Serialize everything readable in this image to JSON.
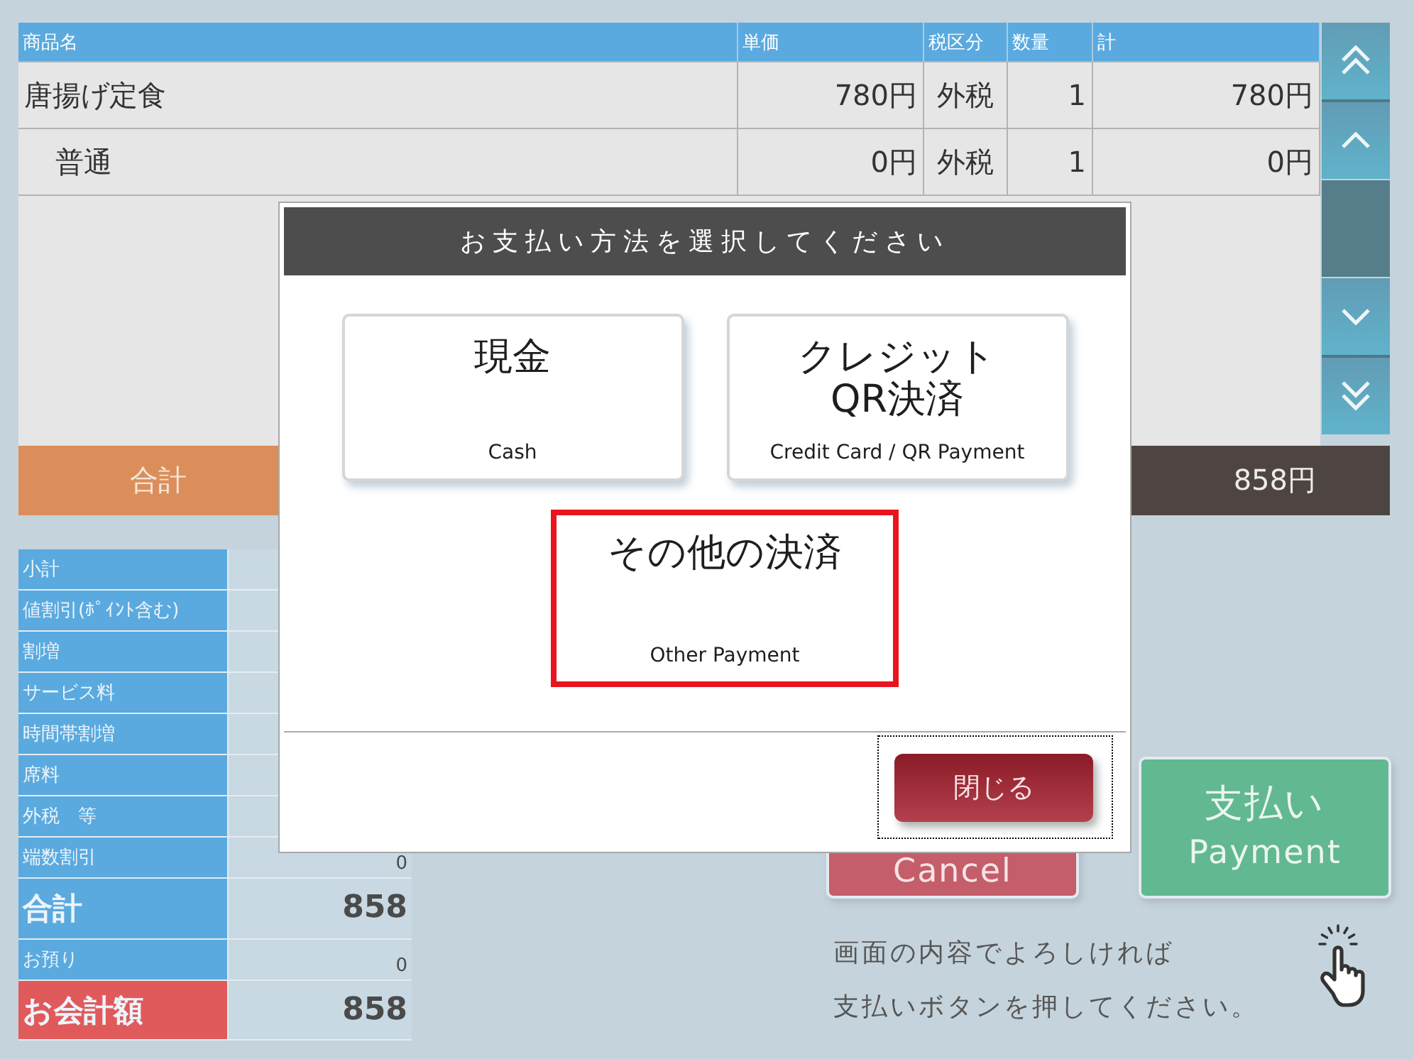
{
  "items_table": {
    "columns": [
      "商品名",
      "単価",
      "税区分",
      "数量",
      "計"
    ],
    "rows": [
      {
        "cells": [
          "唐揚げ定食",
          "780円",
          "外税",
          "1",
          "780円"
        ],
        "children": [
          {
            "cells": [
              "普通",
              "0円",
              "外税",
              "1",
              "0円"
            ]
          }
        ]
      }
    ]
  },
  "total_bar": {
    "label": "合計",
    "amount": "858円"
  },
  "summary": {
    "rows": [
      {
        "label": "小計",
        "kind": "normal"
      },
      {
        "label": "値割引(ﾎﾟｲﾝﾄ含む)",
        "kind": "normal"
      },
      {
        "label": "割増",
        "kind": "normal"
      },
      {
        "label": "サービス料",
        "kind": "normal"
      },
      {
        "label": "時間帯割増",
        "kind": "normal"
      },
      {
        "label": "席料",
        "kind": "normal"
      },
      {
        "label": "外税　等",
        "kind": "normal"
      },
      {
        "label": "端数割引",
        "value": "0",
        "kind": "normal"
      },
      {
        "label": "合計",
        "value": "858",
        "kind": "total"
      },
      {
        "label": "お預り",
        "value": "0",
        "kind": "normal"
      },
      {
        "label": "お会計額",
        "value": "858",
        "kind": "grand"
      }
    ]
  },
  "actions": {
    "cancel": {
      "label": "Cancel"
    },
    "payment": {
      "label": "支払い",
      "sublabel": "Payment"
    }
  },
  "instruction": [
    "画面の内容でよろしければ",
    "支払いボタンを押してください。"
  ],
  "dialog": {
    "title": "お支払い方法を選択してください",
    "options": [
      {
        "label": "現金",
        "sublabel": "Cash",
        "selected": false
      },
      {
        "label": "クレジット\nQR決済",
        "sublabel": "Credit Card / QR Payment",
        "selected": false
      },
      {
        "label": "その他の決済",
        "sublabel": "Other Payment",
        "selected": true
      }
    ],
    "close_button": {
      "label": "閉じる",
      "focused": true
    }
  }
}
